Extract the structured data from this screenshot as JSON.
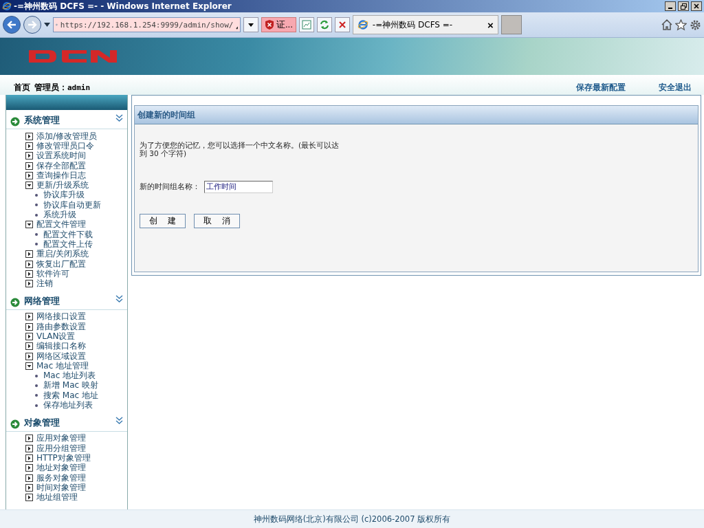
{
  "window": {
    "title": "-=神州数码 DCFS =- - Windows Internet Explorer"
  },
  "browser": {
    "url": "https://192.168.1.254:9999/admin/show/",
    "cert_label": "证...",
    "tab_title": "-=神州数码 DCFS =-",
    "tab_close": "×"
  },
  "header": {
    "home": "首页",
    "admin_label": "管理员：",
    "admin_name": "admin",
    "links": [
      "保存最新配置",
      "安全退出"
    ]
  },
  "sidebar": {
    "sections": [
      {
        "title": "系统管理",
        "items": [
          {
            "label": "添加/修改管理员",
            "expanded": false
          },
          {
            "label": "修改管理员口令",
            "expanded": false
          },
          {
            "label": "设置系统时间",
            "expanded": false
          },
          {
            "label": "保存全部配置",
            "expanded": false
          },
          {
            "label": "查询操作日志",
            "expanded": false
          },
          {
            "label": "更新/升级系统",
            "expanded": true,
            "children": [
              {
                "label": "协议库升级"
              },
              {
                "label": "协议库自动更新"
              },
              {
                "label": "系统升级"
              }
            ]
          },
          {
            "label": "配置文件管理",
            "expanded": true,
            "children": [
              {
                "label": "配置文件下载"
              },
              {
                "label": "配置文件上传"
              }
            ]
          },
          {
            "label": "重启/关闭系统",
            "expanded": false
          },
          {
            "label": "恢复出厂配置",
            "expanded": false
          },
          {
            "label": "软件许可",
            "expanded": false
          },
          {
            "label": "注销",
            "expanded": false
          }
        ]
      },
      {
        "title": "网络管理",
        "items": [
          {
            "label": "网络接口设置",
            "expanded": false
          },
          {
            "label": "路由参数设置",
            "expanded": false
          },
          {
            "label": "VLAN设置",
            "expanded": false
          },
          {
            "label": "编辑接口名称",
            "expanded": false
          },
          {
            "label": "网络区域设置",
            "expanded": false
          },
          {
            "label": "Mac 地址管理",
            "expanded": true,
            "children": [
              {
                "label": "Mac 地址列表"
              },
              {
                "label": "新增 Mac 映射"
              },
              {
                "label": "搜索 Mac 地址"
              },
              {
                "label": "保存地址列表"
              }
            ]
          }
        ]
      },
      {
        "title": "对象管理",
        "items": [
          {
            "label": "应用对象管理",
            "expanded": false
          },
          {
            "label": "应用分组管理",
            "expanded": false
          },
          {
            "label": "HTTP对象管理",
            "expanded": false
          },
          {
            "label": "地址对象管理",
            "expanded": false
          },
          {
            "label": "服务对象管理",
            "expanded": false
          },
          {
            "label": "时间对象管理",
            "expanded": false
          },
          {
            "label": "地址组管理",
            "expanded": false
          }
        ]
      }
    ]
  },
  "form": {
    "title": "创建新的时间组",
    "description": "为了方便您的记忆，您可以选择一个中文名称。(最长可以达到 30 个字符)",
    "field_label": "新的时间组名称：",
    "field_value": "工作时间",
    "buttons": [
      "创 建",
      "取 消"
    ]
  },
  "footer": "神州数码网络(北京)有限公司 (c)2006-2007 版权所有"
}
